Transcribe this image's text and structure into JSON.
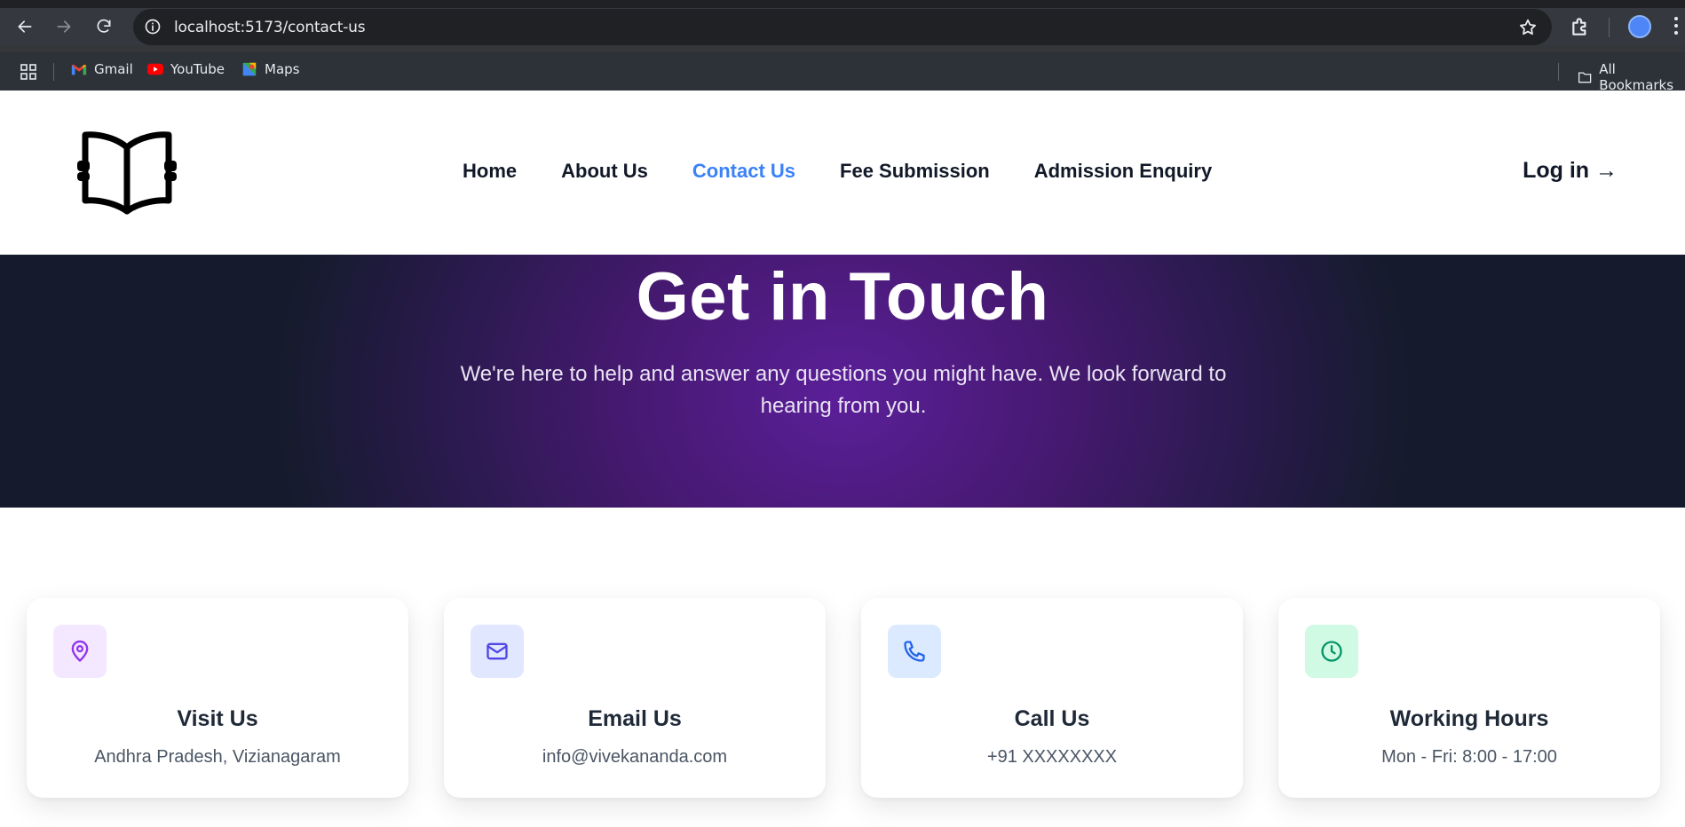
{
  "browser": {
    "url": "localhost:5173/contact-us",
    "bookmarks": [
      {
        "label": "Gmail",
        "icon": "gmail-icon"
      },
      {
        "label": "YouTube",
        "icon": "youtube-icon"
      },
      {
        "label": "Maps",
        "icon": "maps-icon"
      }
    ],
    "all_bookmarks_label": "All Bookmarks"
  },
  "header": {
    "logo_icon": "open-book-icon",
    "nav": [
      "Home",
      "About Us",
      "Contact Us",
      "Fee Submission",
      "Admission Enquiry"
    ],
    "active_nav": "Contact Us",
    "login_label": "Log in →"
  },
  "hero": {
    "title": "Get in Touch",
    "subtitle": "We're here to help and answer any questions you might have. We look forward to hearing from you."
  },
  "cards": [
    {
      "icon": "map-pin-icon",
      "title": "Visit Us",
      "value": "Andhra Pradesh, Vizianagaram",
      "accent": "#9333ea",
      "bg": "#f3e8ff"
    },
    {
      "icon": "mail-icon",
      "title": "Email Us",
      "value": "info@vivekananda.com",
      "accent": "#4f46e5",
      "bg": "#e0e7ff"
    },
    {
      "icon": "phone-icon",
      "title": "Call Us",
      "value": "+91 XXXXXXXX",
      "accent": "#2563eb",
      "bg": "#dbeafe"
    },
    {
      "icon": "clock-icon",
      "title": "Working Hours",
      "value": "Mon - Fri: 8:00 - 17:00",
      "accent": "#059669",
      "bg": "#d1fae5"
    }
  ],
  "colors": {
    "active_link": "#3b82f6",
    "hero_center": "#5b1f99",
    "hero_edge": "#151b2c"
  }
}
